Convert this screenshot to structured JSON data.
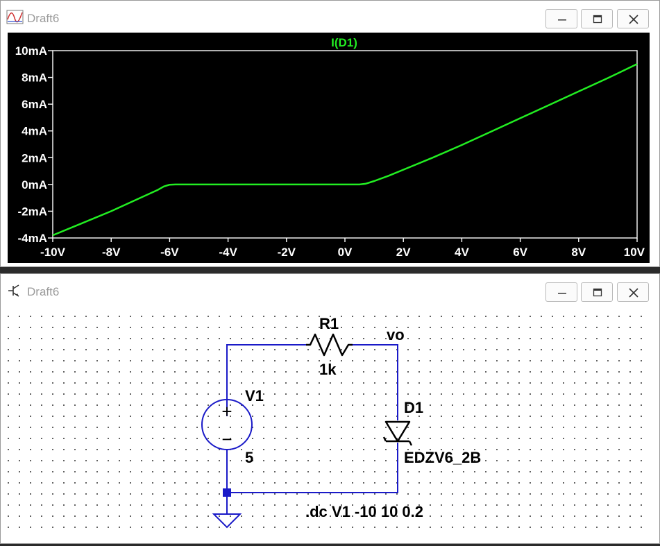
{
  "plot_window": {
    "title": "Draft6",
    "icon": "waveform-window-icon",
    "controls": [
      "minimize-icon",
      "maximize-icon",
      "close-icon"
    ]
  },
  "schematic_window": {
    "title": "Draft6",
    "icon": "schematic-window-icon",
    "controls": [
      "minimize-icon",
      "maximize-icon",
      "close-icon"
    ]
  },
  "colors": {
    "trace": "#22ee22",
    "plot_bg": "#000000",
    "axis_text": "#ffffff",
    "wire": "#1a1ac8"
  },
  "chart_data": {
    "type": "line",
    "title": "I(D1)",
    "xlabel": "",
    "ylabel": "",
    "x_ticks": [
      "-10V",
      "-8V",
      "-6V",
      "-4V",
      "-2V",
      "0V",
      "2V",
      "4V",
      "6V",
      "8V",
      "10V"
    ],
    "y_ticks": [
      "10mA",
      "8mA",
      "6mA",
      "4mA",
      "2mA",
      "0mA",
      "-2mA",
      "-4mA"
    ],
    "xlim": [
      -10,
      10
    ],
    "ylim": [
      -4,
      10
    ],
    "grid": false,
    "series": [
      {
        "name": "I(D1)",
        "x": [
          -10,
          -9,
          -8,
          -7,
          -6.4,
          -6.2,
          -6.0,
          -5.8,
          -4,
          -2,
          0,
          0.5,
          0.7,
          1.0,
          1.5,
          2,
          3,
          4,
          5,
          6,
          7,
          8,
          9,
          10
        ],
        "y": [
          -3.8,
          -2.9,
          -2.0,
          -1.0,
          -0.4,
          -0.15,
          -0.02,
          0,
          0,
          0,
          0,
          0,
          0.05,
          0.25,
          0.65,
          1.1,
          2.0,
          2.95,
          3.95,
          4.95,
          5.95,
          6.95,
          7.95,
          9.0
        ]
      }
    ]
  },
  "schematic": {
    "r1_name": "R1",
    "r1_value": "1k",
    "v1_name": "V1",
    "v1_value": "5",
    "d1_name": "D1",
    "d1_model": "EDZV6_2B",
    "net_label": "vo",
    "directive": ".dc V1 -10 10 0.2",
    "plus_symbol": "+",
    "minus_symbol": "−"
  }
}
